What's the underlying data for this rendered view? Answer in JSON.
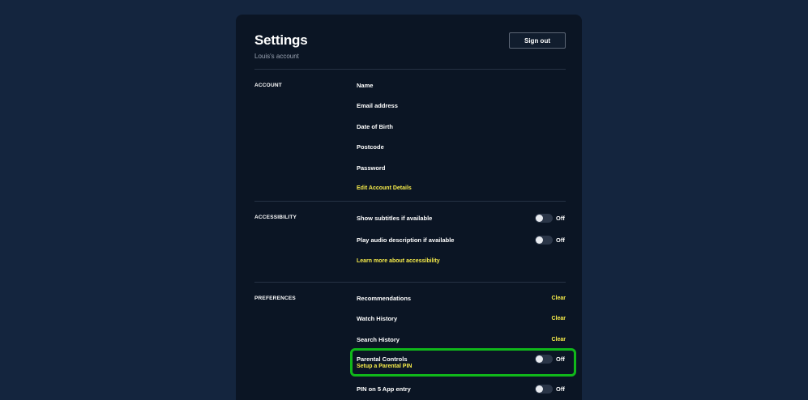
{
  "header": {
    "title": "Settings",
    "subtitle": "Louis's account",
    "signout_label": "Sign out"
  },
  "account": {
    "label": "ACCOUNT",
    "items": [
      "Name",
      "Email address",
      "Date of Birth",
      "Postcode",
      "Password"
    ],
    "edit_link": "Edit Account Details"
  },
  "accessibility": {
    "label": "ACCESSIBILITY",
    "subtitles": {
      "label": "Show subtitles if available",
      "state": "Off"
    },
    "audio_desc": {
      "label": "Play audio description if available",
      "state": "Off"
    },
    "learn_link": "Learn more about accessibility"
  },
  "preferences": {
    "label": "PREFERENCES",
    "recommendations": {
      "label": "Recommendations",
      "action": "Clear"
    },
    "watch_history": {
      "label": "Watch History",
      "action": "Clear"
    },
    "search_history": {
      "label": "Search History",
      "action": "Clear"
    },
    "parental_controls": {
      "label": "Parental Controls",
      "state": "Off",
      "link": "Setup a Parental PIN"
    },
    "pin_entry": {
      "label": "PIN on 5 App entry",
      "state": "Off"
    }
  },
  "colors": {
    "background": "#14253e",
    "panel": "#0b1524",
    "accent": "#f7ec4a",
    "highlight": "#10b81a"
  }
}
